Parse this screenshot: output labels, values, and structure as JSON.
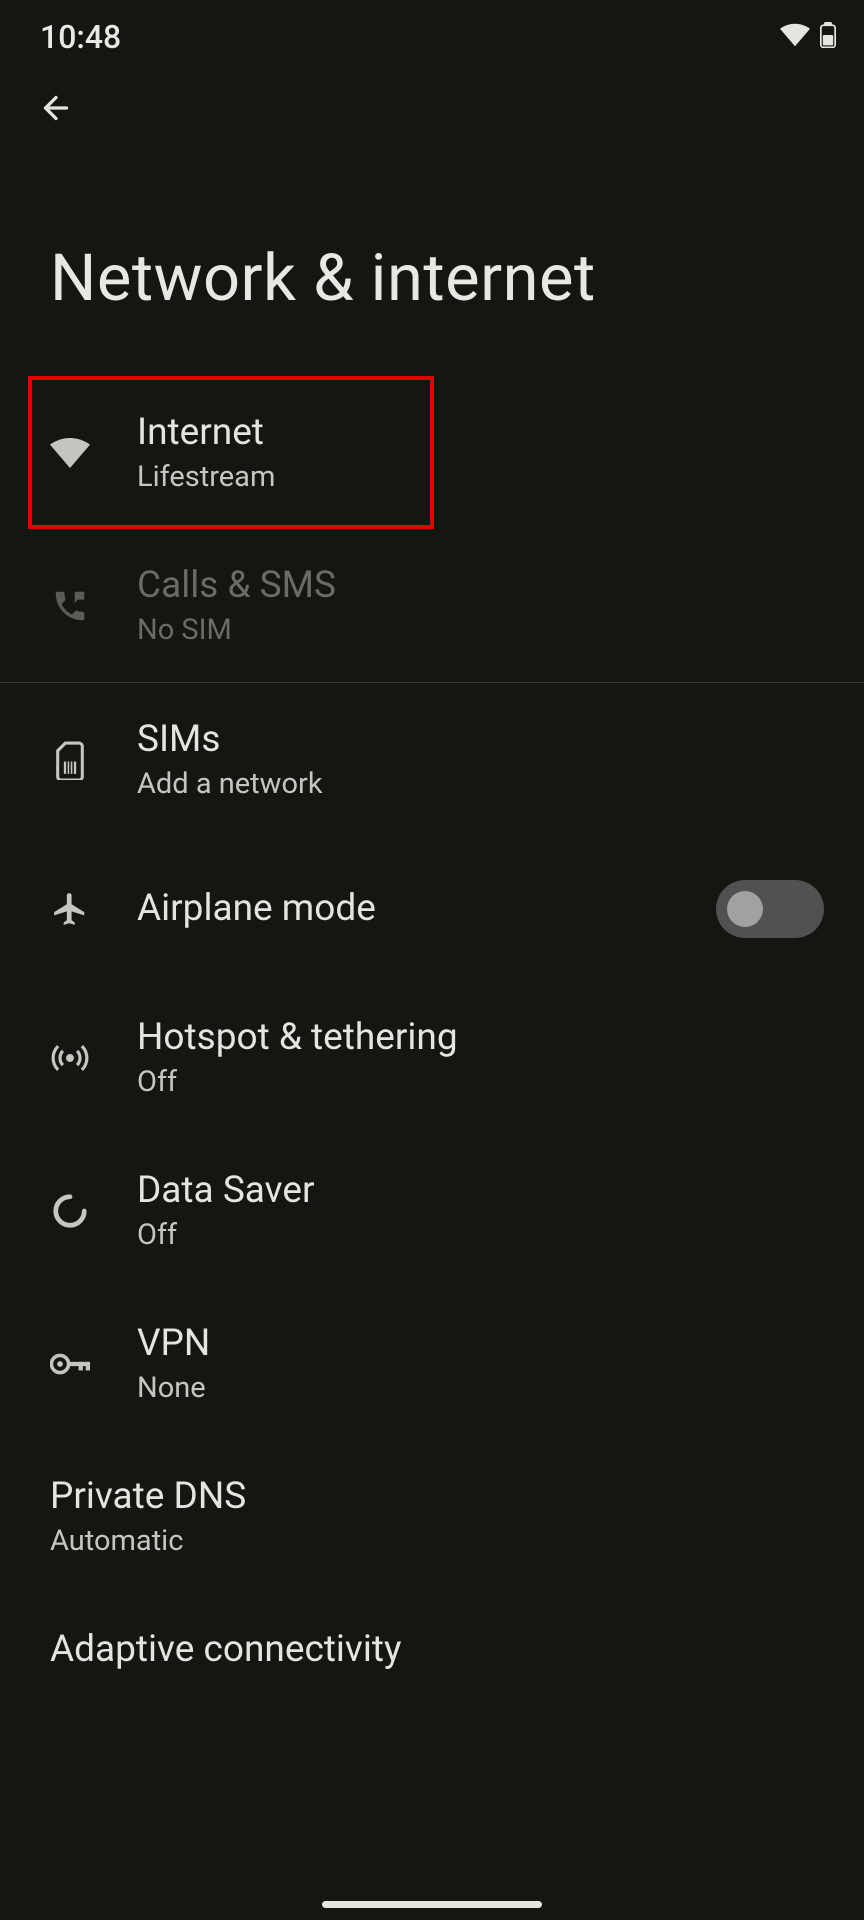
{
  "status": {
    "time": "10:48"
  },
  "page": {
    "title": "Network & internet"
  },
  "items": [
    {
      "title": "Internet",
      "subtitle": "Lifestream"
    },
    {
      "title": "Calls & SMS",
      "subtitle": "No SIM"
    },
    {
      "title": "SIMs",
      "subtitle": "Add a network"
    },
    {
      "title": "Airplane mode",
      "subtitle": ""
    },
    {
      "title": "Hotspot & tethering",
      "subtitle": "Off"
    },
    {
      "title": "Data Saver",
      "subtitle": "Off"
    },
    {
      "title": "VPN",
      "subtitle": "None"
    },
    {
      "title": "Private DNS",
      "subtitle": "Automatic"
    },
    {
      "title": "Adaptive connectivity",
      "subtitle": ""
    }
  ]
}
